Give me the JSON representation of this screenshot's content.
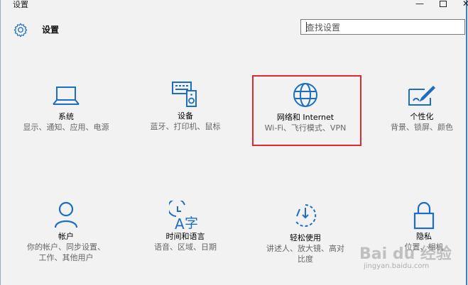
{
  "window": {
    "title": "设置",
    "controls": {
      "minimize": "—",
      "close": "✕"
    }
  },
  "header": {
    "title": "设置",
    "search_placeholder": "查找设置"
  },
  "tiles": [
    {
      "name": "系统",
      "desc": "显示、通知、应用、电源",
      "icon": "laptop-icon"
    },
    {
      "name": "设备",
      "desc": "蓝牙、打印机、鼠标",
      "icon": "keyboard-speaker-icon"
    },
    {
      "name": "网络和 Internet",
      "desc": "Wi-Fi、飞行模式、VPN",
      "icon": "globe-icon"
    },
    {
      "name": "个性化",
      "desc": "背景、锁屏、颜色",
      "icon": "paint-brush-icon"
    },
    {
      "name": "帐户",
      "desc": "你的帐户、同步设置、工作、其他用户",
      "icon": "person-icon"
    },
    {
      "name": "时间和语言",
      "desc": "语音、区域、日期",
      "icon": "time-language-icon"
    },
    {
      "name": "轻松使用",
      "desc": "讲述人、放大镜、高对比度",
      "icon": "ease-of-access-icon"
    },
    {
      "name": "隐私",
      "desc": "位置、相机",
      "icon": "lock-icon"
    }
  ],
  "watermark": {
    "main": "Bai du 经验",
    "sub": "jingyan.baidu.com"
  },
  "colors": {
    "accent": "#1b6ec2",
    "highlight_border": "#e0282e"
  }
}
